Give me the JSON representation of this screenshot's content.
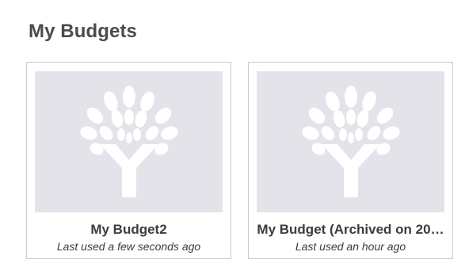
{
  "page": {
    "title": "My Budgets"
  },
  "budgets": [
    {
      "name": "My Budget2",
      "last_used": "Last used a few seconds ago",
      "icon": "ynab-tree-logo-icon"
    },
    {
      "name": "My Budget (Archived on 20…",
      "last_used": "Last used an hour ago",
      "icon": "ynab-tree-logo-icon"
    }
  ],
  "colors": {
    "card_image_bg": "#e3e3e9",
    "logo_fill": "#ffffff",
    "card_border": "#c9c9cf",
    "title_text": "#4a4a4f"
  }
}
